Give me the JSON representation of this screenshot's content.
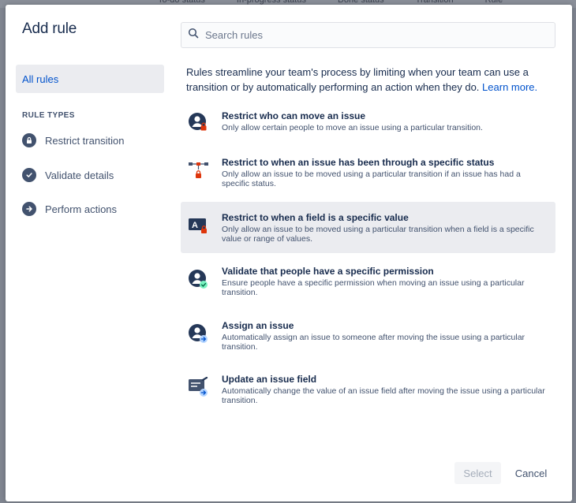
{
  "background": {
    "columns": [
      "To-do status",
      "In-progress status",
      "Done status",
      "Transition",
      "Rule"
    ]
  },
  "dialog": {
    "title": "Add rule",
    "search": {
      "placeholder": "Search rules",
      "value": ""
    },
    "intro": {
      "text": "Rules streamline your team's process by limiting when your team can use a transition or by automatically performing an action when they do.",
      "link": "Learn more."
    },
    "sidebar": {
      "all_rules": "All rules",
      "section_title": "RULE TYPES",
      "items": [
        {
          "label": "Restrict transition",
          "icon": "lock-icon"
        },
        {
          "label": "Validate details",
          "icon": "check-circle-icon"
        },
        {
          "label": "Perform actions",
          "icon": "arrow-right-circle-icon"
        }
      ]
    },
    "rules": [
      {
        "title": "Restrict who can move an issue",
        "description": "Only allow certain people to move an issue using a particular transition.",
        "icon": "person-lock-icon",
        "selected": false
      },
      {
        "title": "Restrict to when an issue has been through a specific status",
        "description": "Only allow an issue to be moved using a particular transition if an issue has had a specific status.",
        "icon": "workflow-lock-icon",
        "selected": false
      },
      {
        "title": "Restrict to when a field is a specific value",
        "description": "Only allow an issue to be moved using a particular transition when a field is a specific value or range of values.",
        "icon": "field-lock-icon",
        "selected": true
      },
      {
        "title": "Validate that people have a specific permission",
        "description": "Ensure people have a specific permission when moving an issue using a particular transition.",
        "icon": "person-check-icon",
        "selected": false
      },
      {
        "title": "Assign an issue",
        "description": "Automatically assign an issue to someone after moving the issue using a particular transition.",
        "icon": "person-arrow-icon",
        "selected": false
      },
      {
        "title": "Update an issue field",
        "description": "Automatically change the value of an issue field after moving the issue using a particular transition.",
        "icon": "field-edit-icon",
        "selected": false
      }
    ],
    "footer": {
      "select_label": "Select",
      "cancel_label": "Cancel"
    }
  },
  "colors": {
    "primary_text": "#172b4d",
    "secondary_text": "#42526e",
    "link": "#0052cc",
    "selected_bg": "#ebecf0",
    "lock_red": "#de350b",
    "check_green": "#36b37e",
    "arrow_blue": "#4c9aff"
  }
}
